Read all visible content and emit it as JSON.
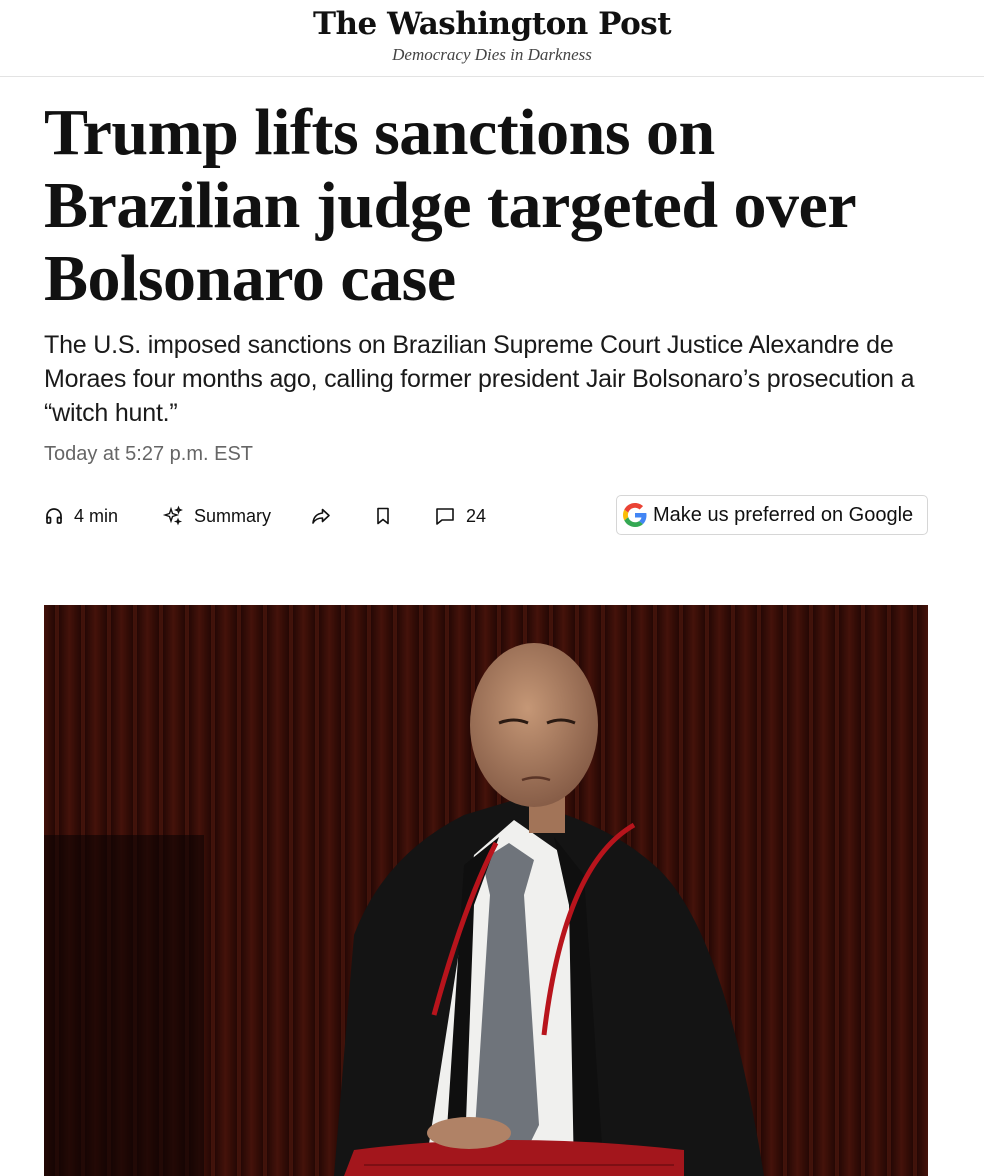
{
  "masthead": {
    "logo": "The Washington Post",
    "tagline": "Democracy Dies in Darkness"
  },
  "article": {
    "headline": "Trump lifts sanctions on Brazilian judge targeted over Bolsonaro case",
    "subheadline": "The U.S. imposed sanctions on Brazilian Supreme Court Justice Alexandre de Moraes four months ago, calling former president Jair Bolsonaro’s prosecution a “witch hunt.”",
    "timestamp": "Today at 5:27 p.m. EST"
  },
  "toolbar": {
    "listen_icon": "headphones-icon",
    "listen_label": "4 min",
    "summary_icon": "sparkle-icon",
    "summary_label": "Summary",
    "share_icon": "share-icon",
    "save_icon": "bookmark-icon",
    "comments_icon": "comment-icon",
    "comments_count": "24",
    "google_icon": "google-g-icon",
    "google_label": "Make us preferred on Google"
  },
  "colors": {
    "google_blue": "#4285F4",
    "google_red": "#EA4335",
    "google_yellow": "#FBBC05",
    "google_green": "#34A853",
    "curtain": "#4a140c",
    "robe": "#141414",
    "cord": "#b8141c"
  }
}
